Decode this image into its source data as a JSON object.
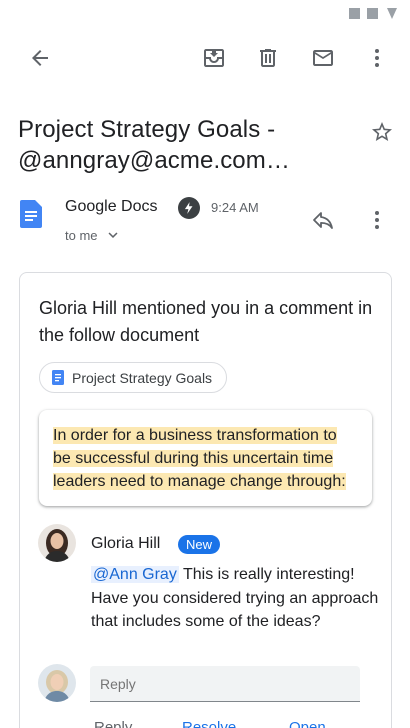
{
  "email": {
    "subject": "Project Strategy Goals - @anngray@acme.com…",
    "sender": "Google Docs",
    "time": "9:24 AM",
    "recipient": "to me"
  },
  "card": {
    "title": "Gloria Hill mentioned you in a comment in the follow document",
    "doc_chip": "Project Strategy Goals",
    "quote": "In order for a business transformation to be successful during this uncertain time leaders need to manage change through:",
    "comment": {
      "author": "Gloria Hill",
      "badge": "New",
      "mention": "@Ann Gray",
      "text": " This is really interesting! Have you considered trying an approach that includes some of the ideas?"
    },
    "reply_placeholder": "Reply",
    "actions": {
      "reply": "Reply",
      "resolve": "Resolve",
      "open": "Open"
    }
  },
  "icons": [
    "back-arrow-icon",
    "archive-icon",
    "trash-icon",
    "mail-icon",
    "more-vert-icon",
    "star-icon",
    "google-docs-icon",
    "bolt-icon",
    "chevron-down-icon",
    "reply-icon"
  ],
  "colors": {
    "accent": "#1a73e8",
    "highlight": "#fce8b2",
    "docs_blue": "#4285f4",
    "icon": "#5f6368"
  }
}
